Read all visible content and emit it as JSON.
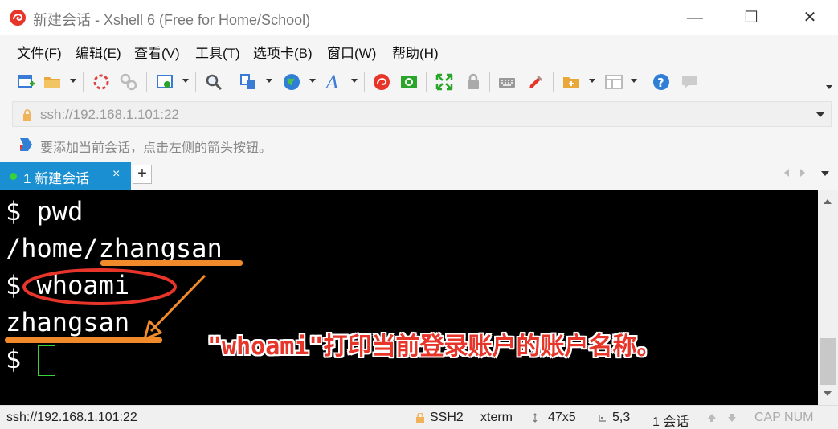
{
  "window": {
    "title": "新建会话 - Xshell 6 (Free for Home/School)",
    "minimize": "—",
    "maximize": "☐",
    "close": "✕"
  },
  "menu": {
    "items": [
      "文件(F)",
      "编辑(E)",
      "查看(V)",
      "工具(T)",
      "选项卡(B)",
      "窗口(W)",
      "帮助(H)"
    ]
  },
  "toolbar": {
    "icons": [
      "new-session-icon",
      "open-folder-icon",
      "connect-icon",
      "disconnect-icon",
      "properties-icon",
      "find-icon",
      "copy-paste-icon",
      "globe-icon",
      "font-icon",
      "xshell-icon",
      "xftp-icon",
      "fullscreen-icon",
      "lock-icon",
      "keyboard-icon",
      "highlight-icon",
      "new-folder-icon",
      "layout-icon",
      "help-icon",
      "chat-icon"
    ]
  },
  "address": {
    "value": "ssh://192.168.1.101:22"
  },
  "hint": {
    "text": "要添加当前会话，点击左侧的箭头按钮。"
  },
  "tabs": {
    "active_label": "1 新建会话",
    "close": "×",
    "add": "+"
  },
  "terminal": {
    "lines": [
      "$ pwd",
      "/home/zhangsan",
      "$ whoami",
      "zhangsan",
      "$ "
    ],
    "annotation": "\"whoami\"打印当前登录账户的账户名称。",
    "colors": {
      "annotation": "#e8352a",
      "highlight": "#f08a2a",
      "cursor": "#3ad13a"
    }
  },
  "status": {
    "connection": "ssh://192.168.1.101:22",
    "protocol": "SSH2",
    "terminal_type": "xterm",
    "size": "47x5",
    "cursor_pos": "5,3",
    "sessions": "1 会话",
    "caps": "CAP NUM"
  }
}
